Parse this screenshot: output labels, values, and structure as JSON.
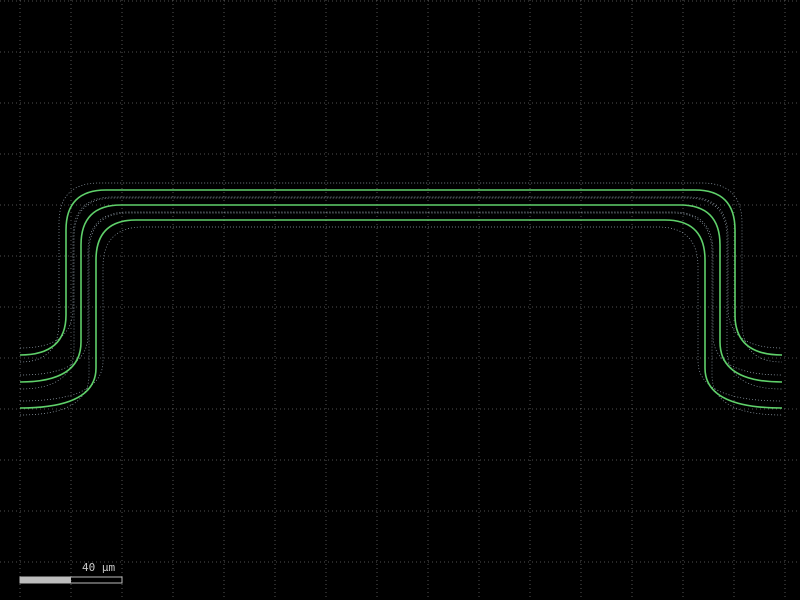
{
  "background_color": "#000000",
  "grid": {
    "visible": true,
    "color": "#6a6a6a"
  },
  "waveguides": {
    "count": 3,
    "core_color": "#5fd06a",
    "cladding_color": "#9aa8b4"
  },
  "scale_bar": {
    "label": "40 µm",
    "fill_color": "#bdbdbd",
    "outline_color": "#bdbdbd"
  }
}
